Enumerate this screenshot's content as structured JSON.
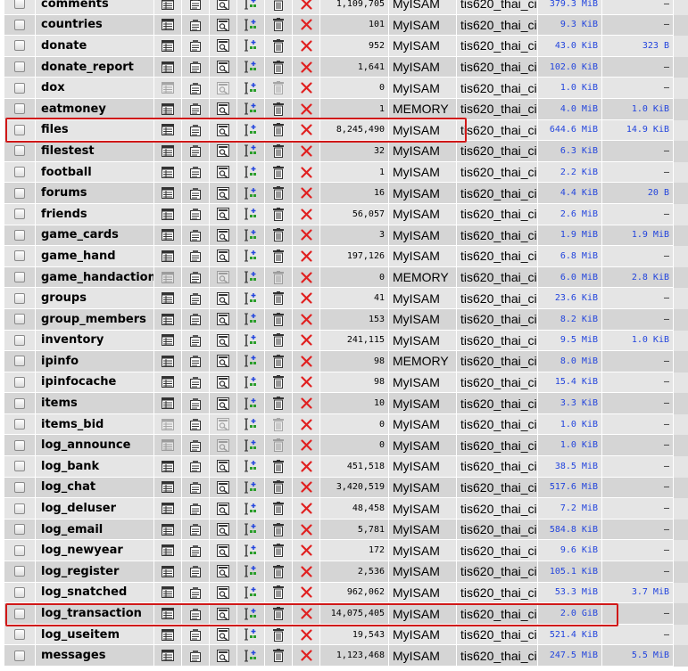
{
  "colors": {
    "row_odd": "#e5e5e5",
    "row_even": "#d5d5d5",
    "size_link": "#2244dd",
    "highlight": "#d01818",
    "drop_icon": "#e02020"
  },
  "icons": [
    "checkbox",
    "browse-icon",
    "structure-icon",
    "search-icon",
    "insert-icon",
    "empty-icon",
    "drop-icon"
  ],
  "tables": [
    {
      "name": "comments",
      "rows": "1,109,705",
      "engine": "MyISAM",
      "collation": "tis620_thai_ci",
      "size": "379.3 MiB",
      "overhead": "–"
    },
    {
      "name": "countries",
      "rows": "101",
      "engine": "MyISAM",
      "collation": "tis620_thai_ci",
      "size": "9.3 KiB",
      "overhead": "–"
    },
    {
      "name": "donate",
      "rows": "952",
      "engine": "MyISAM",
      "collation": "tis620_thai_ci",
      "size": "43.0 KiB",
      "overhead": "323 B"
    },
    {
      "name": "donate_report",
      "rows": "1,641",
      "engine": "MyISAM",
      "collation": "tis620_thai_ci",
      "size": "102.0 KiB",
      "overhead": "–"
    },
    {
      "name": "dox",
      "rows": "0",
      "engine": "MyISAM",
      "collation": "tis620_thai_ci",
      "size": "1.0 KiB",
      "overhead": "–"
    },
    {
      "name": "eatmoney",
      "rows": "1",
      "engine": "MEMORY",
      "collation": "tis620_thai_ci",
      "size": "4.0 MiB",
      "overhead": "1.0 KiB"
    },
    {
      "name": "files",
      "rows": "8,245,490",
      "engine": "MyISAM",
      "collation": "tis620_thai_ci",
      "size": "644.6 MiB",
      "overhead": "14.9 KiB"
    },
    {
      "name": "filestest",
      "rows": "32",
      "engine": "MyISAM",
      "collation": "tis620_thai_ci",
      "size": "6.3 KiB",
      "overhead": "–"
    },
    {
      "name": "football",
      "rows": "1",
      "engine": "MyISAM",
      "collation": "tis620_thai_ci",
      "size": "2.2 KiB",
      "overhead": "–"
    },
    {
      "name": "forums",
      "rows": "16",
      "engine": "MyISAM",
      "collation": "tis620_thai_ci",
      "size": "4.4 KiB",
      "overhead": "20 B"
    },
    {
      "name": "friends",
      "rows": "56,057",
      "engine": "MyISAM",
      "collation": "tis620_thai_ci",
      "size": "2.6 MiB",
      "overhead": "–"
    },
    {
      "name": "game_cards",
      "rows": "3",
      "engine": "MyISAM",
      "collation": "tis620_thai_ci",
      "size": "1.9 MiB",
      "overhead": "1.9 MiB"
    },
    {
      "name": "game_hand",
      "rows": "197,126",
      "engine": "MyISAM",
      "collation": "tis620_thai_ci",
      "size": "6.8 MiB",
      "overhead": "–"
    },
    {
      "name": "game_handaction",
      "rows": "0",
      "engine": "MEMORY",
      "collation": "tis620_thai_ci",
      "size": "6.0 MiB",
      "overhead": "2.8 KiB"
    },
    {
      "name": "groups",
      "rows": "41",
      "engine": "MyISAM",
      "collation": "tis620_thai_ci",
      "size": "23.6 KiB",
      "overhead": "–"
    },
    {
      "name": "group_members",
      "rows": "153",
      "engine": "MyISAM",
      "collation": "tis620_thai_ci",
      "size": "8.2 KiB",
      "overhead": "–"
    },
    {
      "name": "inventory",
      "rows": "241,115",
      "engine": "MyISAM",
      "collation": "tis620_thai_ci",
      "size": "9.5 MiB",
      "overhead": "1.0 KiB"
    },
    {
      "name": "ipinfo",
      "rows": "98",
      "engine": "MEMORY",
      "collation": "tis620_thai_ci",
      "size": "8.0 MiB",
      "overhead": "–"
    },
    {
      "name": "ipinfocache",
      "rows": "98",
      "engine": "MyISAM",
      "collation": "tis620_thai_ci",
      "size": "15.4 KiB",
      "overhead": "–"
    },
    {
      "name": "items",
      "rows": "10",
      "engine": "MyISAM",
      "collation": "tis620_thai_ci",
      "size": "3.3 KiB",
      "overhead": "–"
    },
    {
      "name": "items_bid",
      "rows": "0",
      "engine": "MyISAM",
      "collation": "tis620_thai_ci",
      "size": "1.0 KiB",
      "overhead": "–"
    },
    {
      "name": "log_announce",
      "rows": "0",
      "engine": "MyISAM",
      "collation": "tis620_thai_ci",
      "size": "1.0 KiB",
      "overhead": "–"
    },
    {
      "name": "log_bank",
      "rows": "451,518",
      "engine": "MyISAM",
      "collation": "tis620_thai_ci",
      "size": "38.5 MiB",
      "overhead": "–"
    },
    {
      "name": "log_chat",
      "rows": "3,420,519",
      "engine": "MyISAM",
      "collation": "tis620_thai_ci",
      "size": "517.6 MiB",
      "overhead": "–"
    },
    {
      "name": "log_deluser",
      "rows": "48,458",
      "engine": "MyISAM",
      "collation": "tis620_thai_ci",
      "size": "7.2 MiB",
      "overhead": "–"
    },
    {
      "name": "log_email",
      "rows": "5,781",
      "engine": "MyISAM",
      "collation": "tis620_thai_ci",
      "size": "584.8 KiB",
      "overhead": "–"
    },
    {
      "name": "log_newyear",
      "rows": "172",
      "engine": "MyISAM",
      "collation": "tis620_thai_ci",
      "size": "9.6 KiB",
      "overhead": "–"
    },
    {
      "name": "log_register",
      "rows": "2,536",
      "engine": "MyISAM",
      "collation": "tis620_thai_ci",
      "size": "105.1 KiB",
      "overhead": "–"
    },
    {
      "name": "log_snatched",
      "rows": "962,062",
      "engine": "MyISAM",
      "collation": "tis620_thai_ci",
      "size": "53.3 MiB",
      "overhead": "3.7 MiB"
    },
    {
      "name": "log_transaction",
      "rows": "14,075,405",
      "engine": "MyISAM",
      "collation": "tis620_thai_ci",
      "size": "2.0 GiB",
      "overhead": "–"
    },
    {
      "name": "log_useitem",
      "rows": "19,543",
      "engine": "MyISAM",
      "collation": "tis620_thai_ci",
      "size": "521.4 KiB",
      "overhead": "–"
    },
    {
      "name": "messages",
      "rows": "1,123,468",
      "engine": "MyISAM",
      "collation": "tis620_thai_ci",
      "size": "247.5 MiB",
      "overhead": "5.5 MiB"
    }
  ],
  "highlighted_tables": [
    "files",
    "log_transaction"
  ]
}
